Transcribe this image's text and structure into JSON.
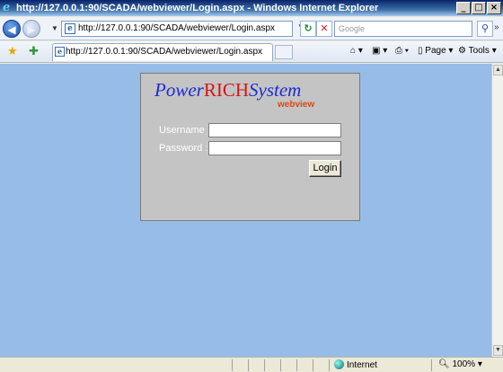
{
  "window": {
    "title": "http://127.0.0.1:90/SCADA/webviewer/Login.aspx - Windows Internet Explorer"
  },
  "nav": {
    "address": "http://127.0.0.1:90/SCADA/webviewer/Login.aspx",
    "search_placeholder": "Google"
  },
  "tab": {
    "title": "http://127.0.0.1:90/SCADA/webviewer/Login.aspx"
  },
  "command": {
    "page": "Page",
    "tools": "Tools"
  },
  "login": {
    "brand_power": "Power",
    "brand_rich": "RICH",
    "brand_system": "System",
    "subtitle": "webview",
    "username_label": "Username :",
    "password_label": "Password :",
    "username_value": "",
    "password_value": "",
    "button": "Login"
  },
  "status": {
    "zone": "Internet",
    "zoom": "100%"
  },
  "colors": {
    "page_bg": "#97bce7",
    "panel_bg": "#c4c4c4",
    "brand_blue": "#1c2bd6",
    "brand_red": "#d41515",
    "subtitle": "#d54a1a"
  }
}
